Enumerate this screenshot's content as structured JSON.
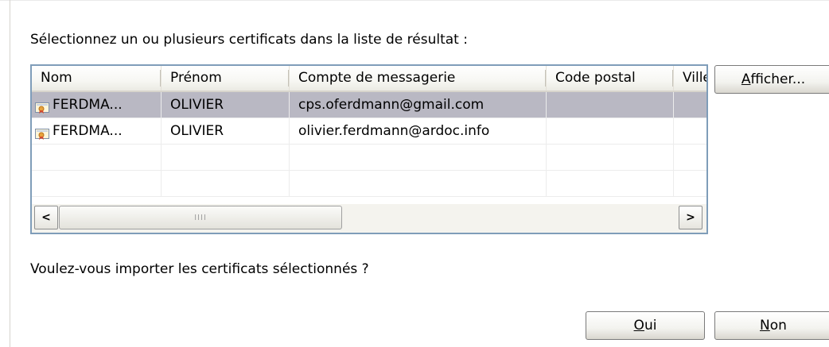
{
  "labels": {
    "select_instruction": "Sélectionnez un ou plusieurs certificats dans la liste de résultat :",
    "import_question": "Voulez-vous importer les certificats sélectionnés ?"
  },
  "table": {
    "columns": [
      "Nom",
      "Prénom",
      "Compte de messagerie",
      "Code postal",
      "Ville"
    ],
    "rows": [
      {
        "nom": "FERDMA...",
        "prenom": "OLIVIER",
        "email": "cps.oferdmann@gmail.com",
        "code_postal": "",
        "ville": "",
        "selected": true,
        "icon": "certificate-icon"
      },
      {
        "nom": "FERDMA...",
        "prenom": "OLIVIER",
        "email": "olivier.ferdmann@ardoc.info",
        "code_postal": "",
        "ville": "",
        "selected": false,
        "icon": "certificate-icon"
      }
    ],
    "empty_rows": 2
  },
  "scrollbar": {
    "left_arrow": "<",
    "right_arrow": ">",
    "grip": "IIII"
  },
  "buttons": {
    "afficher": {
      "mnemonic": "A",
      "rest": "fficher..."
    },
    "oui": {
      "mnemonic": "O",
      "rest": "ui"
    },
    "non": {
      "mnemonic": "N",
      "rest": "on"
    }
  },
  "colors": {
    "selection": "#b9b8c3",
    "list_border": "#7f9db9"
  }
}
